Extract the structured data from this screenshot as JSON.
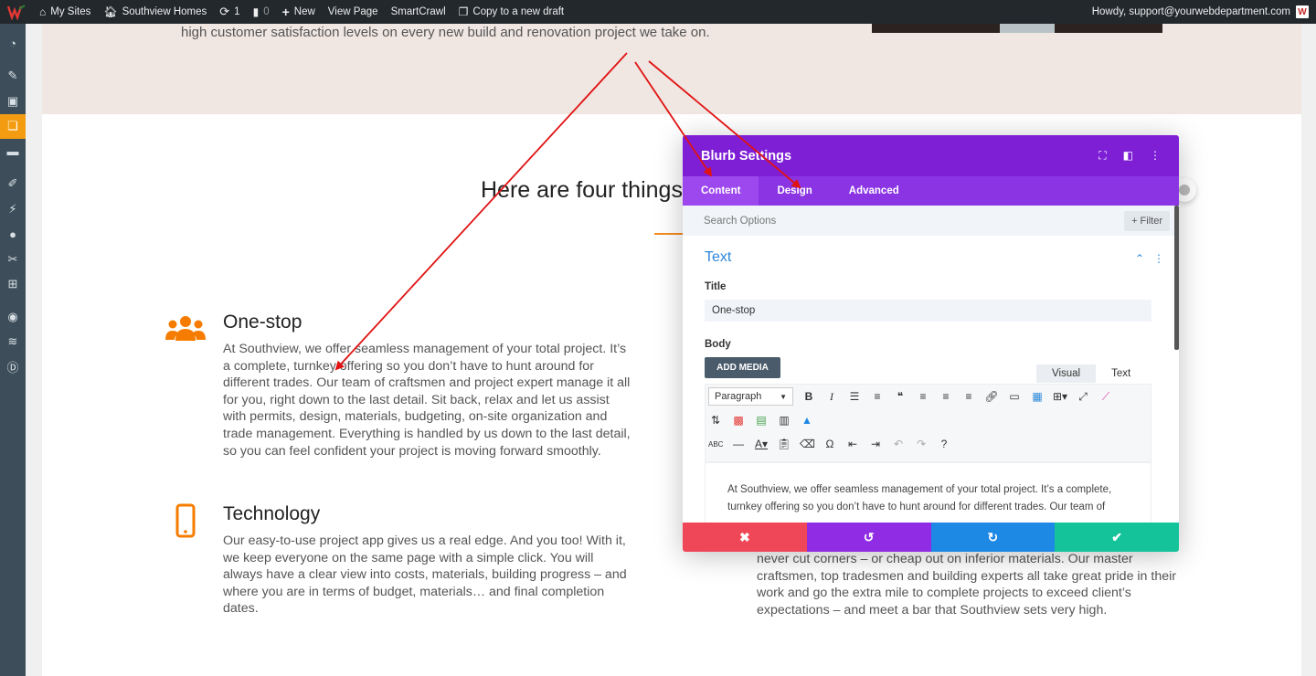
{
  "adminbar": {
    "my_sites": "My Sites",
    "site_name": "Southview Homes",
    "updates_count": "1",
    "comments_count": "0",
    "new_label": "New",
    "view_page": "View Page",
    "smartcrawl": "SmartCrawl",
    "copy_draft": "Copy to a new draft",
    "howdy": "Howdy, support@yourwebdepartment.com"
  },
  "hero": {
    "text": "high customer satisfaction levels on every new build and renovation project we take on."
  },
  "section": {
    "heading": "Here are four things"
  },
  "features": [
    {
      "icon": "users-icon",
      "title": "One-stop",
      "body": "At Southview, we offer seamless management of your total project. It’s a complete, turnkey offering so you don’t have to hunt around for different trades. Our team of craftsmen and project expert manage it all for you, right down to the last detail. Sit back, relax and let us assist with permits, design, materials, budgeting, on-site organization and trade management. Everything is handled by us down to the last detail, so you can feel confident your project is moving forward smoothly."
    },
    {
      "icon": "mobile-icon",
      "title": "Technology",
      "body": "Our easy-to-use project app gives us a real edge. And you too!  With it, we keep everyone on the same page with a simple click. You will always have a clear view into costs, materials, building progress – and where you are in terms of budget, materials… and final completion dates."
    }
  ],
  "right_partial": {
    "body": "never cut corners – or cheap out on inferior materials. Our master craftsmen, top tradesmen and building experts all take great pride in their work and go the extra mile to complete projects to exceed client’s expectations – and meet a bar that Southview sets very high."
  },
  "modal": {
    "title": "Blurb Settings",
    "tabs": [
      "Content",
      "Design",
      "Advanced"
    ],
    "search_placeholder": "Search Options",
    "filter_label": "Filter",
    "group_title": "Text",
    "title_label": "Title",
    "title_value": "One-stop",
    "body_label": "Body",
    "add_media": "ADD MEDIA",
    "editor_tabs": [
      "Visual",
      "Text"
    ],
    "format_select": "Paragraph",
    "editor_text": "At Southview, we offer seamless management of your total project. It’s a complete, turnkey offering so you don’t have to hunt around for different trades. Our team of"
  },
  "colors": {
    "accent_purple": "#7e1fd6",
    "tab_purple": "#8a34e4",
    "link_blue": "#2b87da",
    "orange": "#f57c00",
    "cancel_red": "#ef4757",
    "undo_purple": "#8f2ce4",
    "redo_blue": "#1e88e5",
    "save_green": "#15c39a",
    "arrow_red": "#e01212"
  }
}
